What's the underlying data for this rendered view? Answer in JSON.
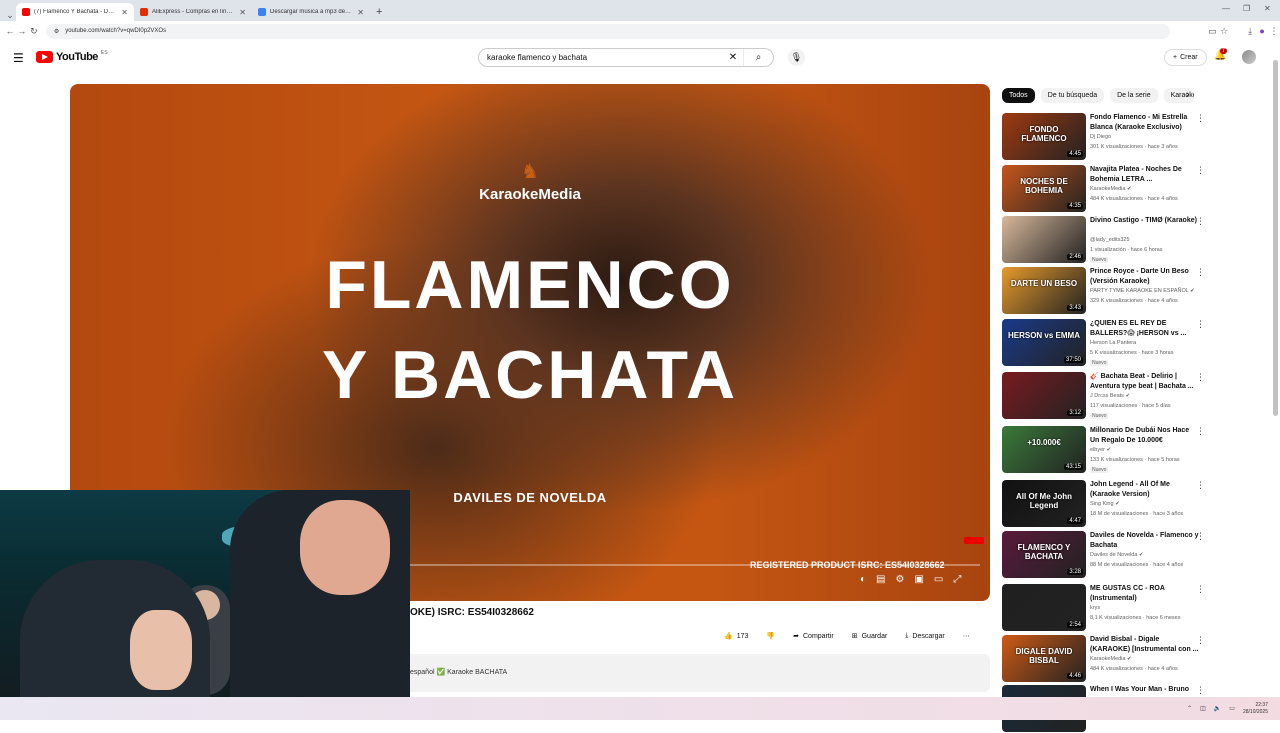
{
  "browser": {
    "tabs": [
      {
        "title": "(7) Flamenco Y Bachata - Davile",
        "color": "#ff0000",
        "active": true
      },
      {
        "title": "AliExpress - Compras en línea p",
        "color": "#e62e04",
        "active": false
      },
      {
        "title": "Descargar música a mp3 desde",
        "color": "#3b82f6",
        "active": false
      }
    ],
    "url": "youtube.com/watch?v=qwDI0p2VXOs",
    "new_tab": "+"
  },
  "youtube": {
    "logo": "YouTube",
    "country": "ES",
    "search_query": "karaoke flamenco y bachata",
    "create_label": "Crear",
    "notifications": "7"
  },
  "video": {
    "brand": "KaraokeMedia",
    "title_line1": "FLAMENCO",
    "title_line2": "Y BACHATA",
    "artist": "DAVILES DE NOVELDA",
    "isrc": "REGISTERED PRODUCT ISRC: ES54I0328662",
    "visible_title": "OKE) ISRC: ES54I0328662",
    "likes": "173",
    "share": "Compartir",
    "save": "Guardar",
    "download": "Descargar",
    "description": "español ✅ Karaoke BACHATA"
  },
  "chips": [
    "Todos",
    "De tu búsqueda",
    "De la serie",
    "Karaoke"
  ],
  "recommendations": [
    {
      "title": "Fondo Flamenco - Mi Estrella Blanca (Karaoke Exclusivo)",
      "channel": "Dj Diego",
      "views": "301 K visualizaciones · hace 3 años",
      "duration": "4:45",
      "thumb_text": "FONDO FLAMENCO",
      "thumb_color": "#a03a10",
      "new": ""
    },
    {
      "title": "Navajita Platea - Noches De Bohemia LETRA ...",
      "channel": "KaraokeMedia ✔",
      "views": "484 K visualizaciones · hace 4 años",
      "duration": "4:35",
      "thumb_text": "NOCHES DE BOHEMIA",
      "thumb_color": "#c8561a",
      "new": ""
    },
    {
      "title": "Divino Castigo - TIMØ (Karaoke)",
      "channel": "@lady_edits325",
      "views": "1 visualización · hace 6 horas",
      "duration": "2:46",
      "thumb_text": "",
      "thumb_color": "#d8b89a",
      "new": "Nuevo"
    },
    {
      "title": "Prince Royce - Darte Un Beso (Versión Karaoke)",
      "channel": "PARTY TYME KARAOKE EN ESPAÑOL ✔",
      "views": "329 K visualizaciones · hace 4 años",
      "duration": "3:43",
      "thumb_text": "DARTE UN BESO",
      "thumb_color": "#e89a2a",
      "new": ""
    },
    {
      "title": "¿QUIEN ES EL REY DE BALLERS?😱 ¡HERSON vs ...",
      "channel": "Herson La Pantera",
      "views": "5 K visualizaciones · hace 3 horas",
      "duration": "37:50",
      "thumb_text": "HERSON vs EMMA",
      "thumb_color": "#1a3a8a",
      "new": "Nuevo"
    },
    {
      "title": "🎸 Bachata Beat - Delirio | Aventura type beat | Bachata ...",
      "channel": "J Drcss Beats ✔",
      "views": "117 visualizaciones · hace 5 días",
      "duration": "3:12",
      "thumb_text": "",
      "thumb_color": "#7a1a20",
      "new": "Nuevo"
    },
    {
      "title": "Millonario De Dubái Nos Hace Un Regalo De 10.000€",
      "channel": "elbyer ✔",
      "views": "133 K visualizaciones · hace 5 horas",
      "duration": "43:15",
      "thumb_text": "+10.000€",
      "thumb_color": "#3a7a3a",
      "new": "Nuevo"
    },
    {
      "title": "John Legend - All Of Me (Karaoke Version)",
      "channel": "Sing King ✔",
      "views": "18 M de visualizaciones · hace 3 años",
      "duration": "4:47",
      "thumb_text": "All Of Me John Legend",
      "thumb_color": "#111111",
      "new": ""
    },
    {
      "title": "Daviles de Novelda - Flamenco y Bachata",
      "channel": "Daviles de Novelda ✔",
      "views": "88 M de visualizaciones · hace 4 años",
      "duration": "3:28",
      "thumb_text": "FLAMENCO Y BACHATA",
      "thumb_color": "#5a1a3a",
      "new": ""
    },
    {
      "title": "ME GUSTAS CC - ROA (Instrumental)",
      "channel": "krys",
      "views": "8,1 K visualizaciones · hace 6 meses",
      "duration": "2:54",
      "thumb_text": "",
      "thumb_color": "#202020",
      "new": ""
    },
    {
      "title": "David Bisbal - Digale (KARAOKE) [Instrumental con ...",
      "channel": "KaraokeMedia ✔",
      "views": "484 K visualizaciones · hace 4 años",
      "duration": "4:46",
      "thumb_text": "DIGALE DAVID BISBAL",
      "thumb_color": "#d05a14",
      "new": ""
    },
    {
      "title": "When I Was Your Man - Bruno",
      "channel": "",
      "views": "",
      "duration": "",
      "thumb_text": "",
      "thumb_color": "#1a2a3a",
      "new": ""
    }
  ],
  "taskbar": {
    "time": "22:37",
    "date": "28/10/2025"
  }
}
